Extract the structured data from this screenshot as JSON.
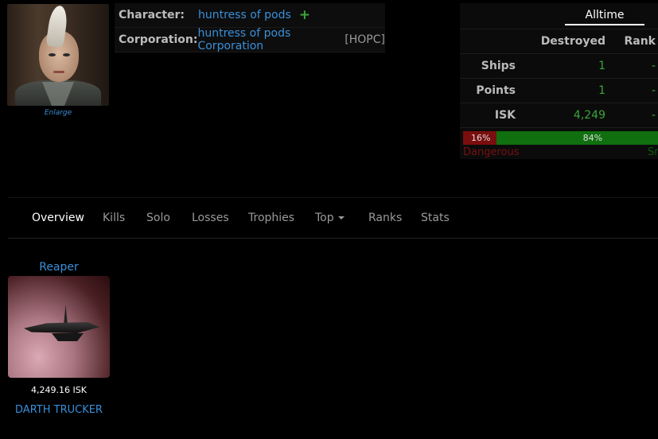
{
  "character": {
    "enlarge_label": "Enlarge",
    "character_label": "Character:",
    "character_name": "huntress of pods",
    "corporation_label": "Corporation:",
    "corporation_name": "huntress of pods Corporation",
    "corporation_ticker": "[HOPC]"
  },
  "stats": {
    "tab_label": "Alltime",
    "headers": {
      "destroyed": "Destroyed",
      "rank": "Rank"
    },
    "rows": [
      {
        "label": "Ships",
        "destroyed": "1",
        "rank": "-"
      },
      {
        "label": "Points",
        "destroyed": "1",
        "rank": "-"
      },
      {
        "label": "ISK",
        "destroyed": "4,249",
        "rank": "-"
      }
    ],
    "danger_percent_label": "16%",
    "snuggly_percent_label": "84%",
    "danger_fraction": 0.16,
    "danger_label": "Dangerous",
    "snuggly_label_partial": "Sn",
    "colors": {
      "danger": "#7a0e0e",
      "snuggly": "#10700f"
    }
  },
  "nav": {
    "items": [
      "Overview",
      "Kills",
      "Solo",
      "Losses",
      "Trophies",
      "Top",
      "Ranks",
      "Stats"
    ],
    "active": "Overview"
  },
  "top_kill": {
    "ship_name": "Reaper",
    "isk_value": "4,249.16 ISK",
    "pilot_name": "DARTH TRUCKER"
  },
  "icons": {
    "add": "plus-icon",
    "dropdown": "caret-down-icon"
  },
  "colors": {
    "link": "#3a8fd9",
    "positive": "#3aa63a",
    "background": "#000000"
  }
}
